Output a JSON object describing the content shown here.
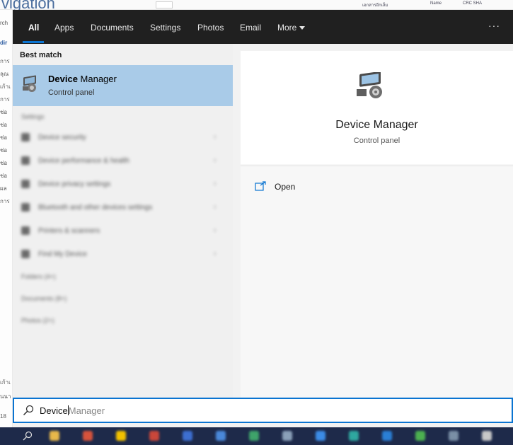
{
  "background": {
    "title_fragment": "vigation",
    "file_labels": [
      "เอกสารอีกเล็ม",
      "Name",
      "CRC SHA"
    ],
    "left_fragments": [
      "rch",
      "dir",
      "การ",
      "ลุณ",
      "เก้าเ",
      "การ",
      "ช่อ",
      "ช่อ",
      "ช่อ",
      "ช่อ",
      "ช่อ",
      "ช่อ",
      "ผล",
      "การ",
      "เก้าเ",
      "นนา",
      "18"
    ]
  },
  "nav": {
    "tabs": [
      "All",
      "Apps",
      "Documents",
      "Settings",
      "Photos",
      "Email"
    ],
    "more_label": "More",
    "dots": "···"
  },
  "best_match": {
    "section_label": "Best match",
    "title_bold": "Device",
    "title_rest": " Manager",
    "subtitle": "Control panel"
  },
  "results": {
    "settings_header": "Settings",
    "rows": [
      "Device security",
      "Device performance & health",
      "Device privacy settings",
      "Bluetooth and other devices settings",
      "Printers & scanners",
      "Find My Device"
    ],
    "groups": [
      "Folders (4+)",
      "Documents (8+)",
      "Photos (2+)"
    ]
  },
  "preview": {
    "title": "Device Manager",
    "subtitle": "Control panel",
    "action_open": "Open"
  },
  "search": {
    "typed": "Device",
    "completion": "Manager"
  },
  "colors": {
    "accent": "#0a74d1",
    "selection": "#a9cbe8",
    "nav_bg": "#202020",
    "taskbar_bg": "#1e2a4a"
  },
  "taskbar": {
    "apps": [
      "file-explorer",
      "chrome",
      "folder",
      "office",
      "mail",
      "teams",
      "app",
      "settings",
      "store",
      "vscode",
      "app",
      "app",
      "app",
      "app"
    ]
  }
}
